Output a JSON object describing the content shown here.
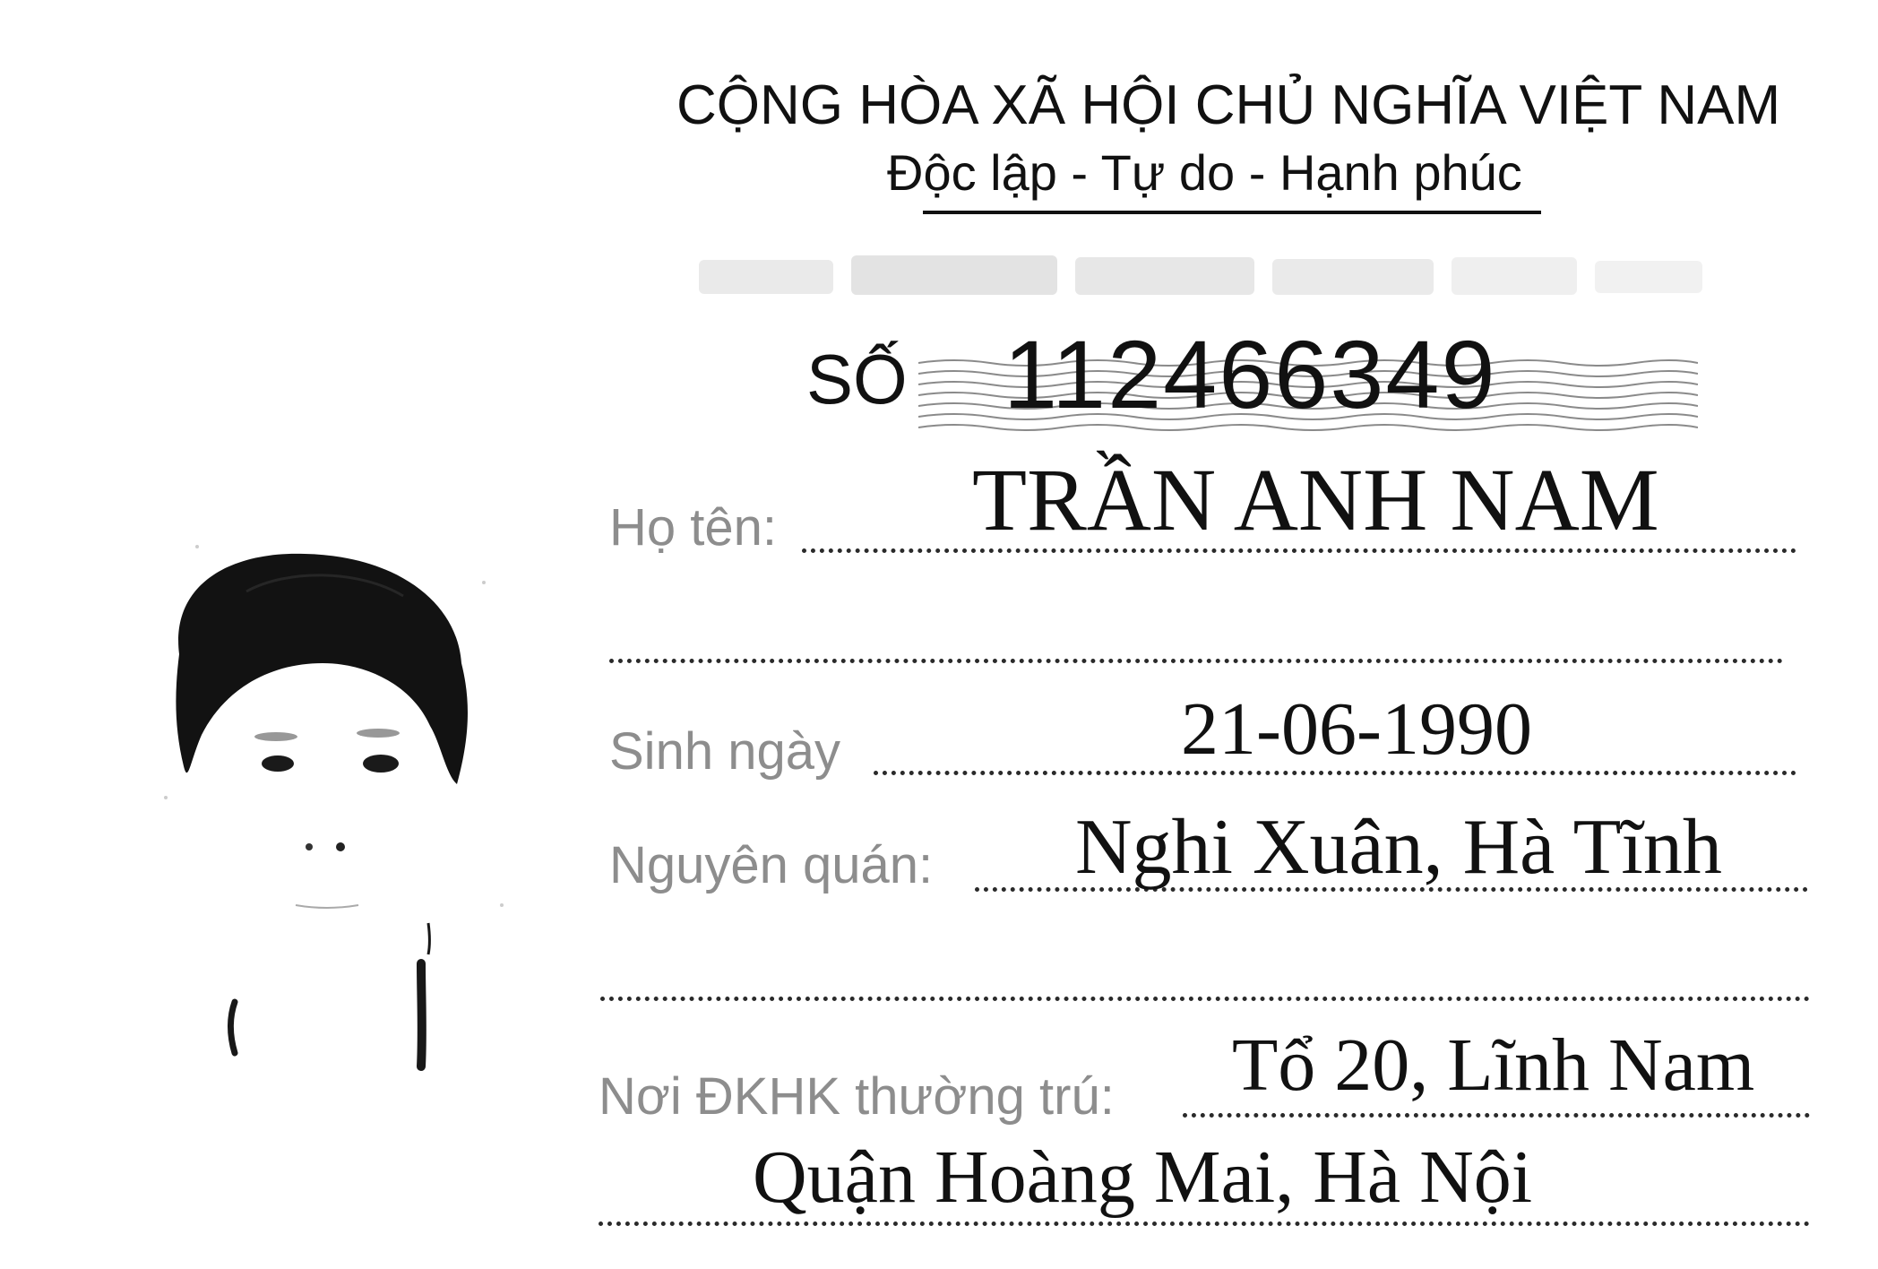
{
  "header": {
    "country": "CỘNG HÒA XÃ HỘI CHỦ NGHĨA VIỆT NAM",
    "motto": "Độc lập - Tự do - Hạnh phúc"
  },
  "card": {
    "number_label": "SỐ",
    "number": "112466349"
  },
  "fields": {
    "name_label": "Họ tên:",
    "name_value": "TRẦN ANH NAM",
    "dob_label": "Sinh ngày",
    "dob_value": "21-06-1990",
    "origin_label": "Nguyên quán:",
    "origin_value": "Nghi Xuân, Hà Tĩnh",
    "residence_label": "Nơi ĐKHK thường trú:",
    "residence_value_line1": "Tổ 20, Lĩnh Nam",
    "residence_value_line2": "Quận Hoàng Mai, Hà Nội"
  }
}
